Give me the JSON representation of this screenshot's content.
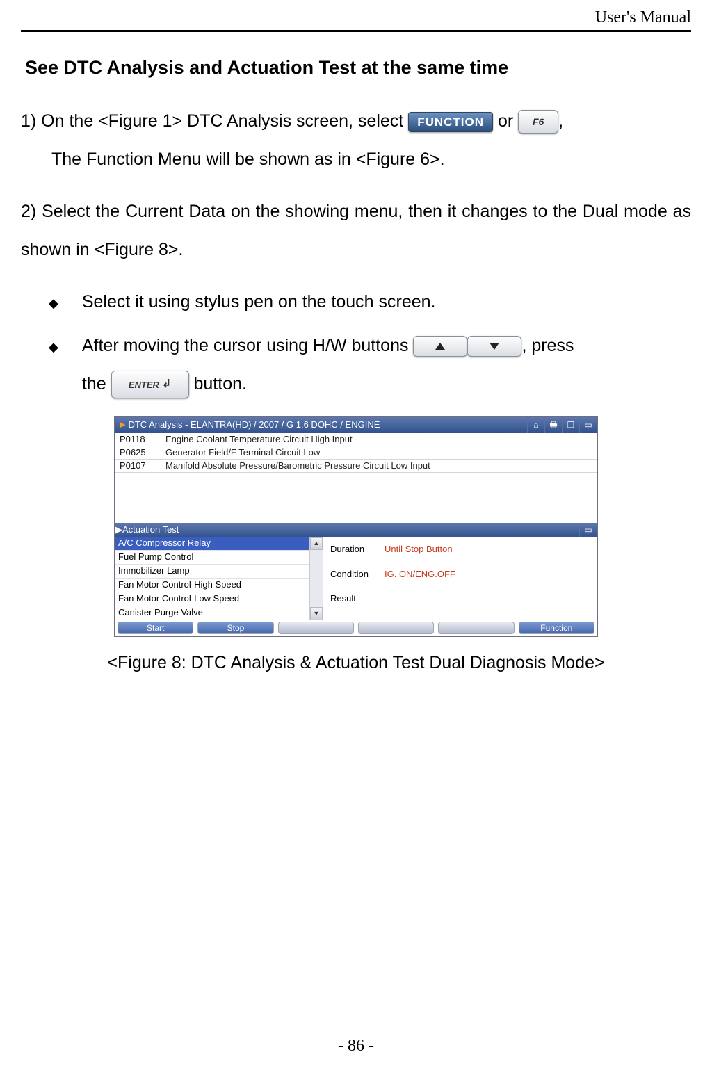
{
  "header": {
    "title": "User's Manual"
  },
  "section_heading": "See DTC Analysis and Actuation Test at the same time",
  "step1": {
    "part1": "1) On the <Figure 1> DTC Analysis screen, select ",
    "part_or": " or ",
    "part_end": ",",
    "line2": "The Function Menu will be shown as in <Figure 6>."
  },
  "step2": {
    "text": "2) Select the Current Data on the showing menu, then it changes to the Dual mode as shown in <Figure 8>."
  },
  "bullets": {
    "b1": "Select it using stylus pen on the touch screen.",
    "b2a": "After moving the cursor using H/W buttons ",
    "b2b": ", press",
    "b2c": "the ",
    "b2d": " button."
  },
  "buttons": {
    "function_label": "FUNCTION",
    "f6_label": "F6",
    "enter_label": "ENTER"
  },
  "figure8": {
    "title": "DTC Analysis - ELANTRA(HD) / 2007 / G 1.6 DOHC / ENGINE",
    "dtc_rows": [
      {
        "code": "P0118",
        "desc": "Engine Coolant Temperature Circuit High Input"
      },
      {
        "code": "P0625",
        "desc": "Generator Field/F Terminal Circuit Low"
      },
      {
        "code": "P0107",
        "desc": "Manifold Absolute Pressure/Barometric Pressure Circuit Low Input"
      }
    ],
    "actuation_title": "Actuation Test",
    "act_items": [
      "A/C Compressor Relay",
      "Fuel Pump Control",
      "Immobilizer Lamp",
      "Fan Motor Control-High Speed",
      "Fan Motor Control-Low Speed",
      "Canister Purge Valve"
    ],
    "info": {
      "duration_k": "Duration",
      "duration_v": "Until Stop Button",
      "condition_k": "Condition",
      "condition_v": "IG. ON/ENG.OFF",
      "result_k": "Result",
      "result_v": ""
    },
    "tabs": {
      "start": "Start",
      "stop": "Stop",
      "function": "Function"
    }
  },
  "figure_caption": "<Figure 8: DTC Analysis & Actuation Test Dual Diagnosis Mode>",
  "page_number": "- 86 -"
}
